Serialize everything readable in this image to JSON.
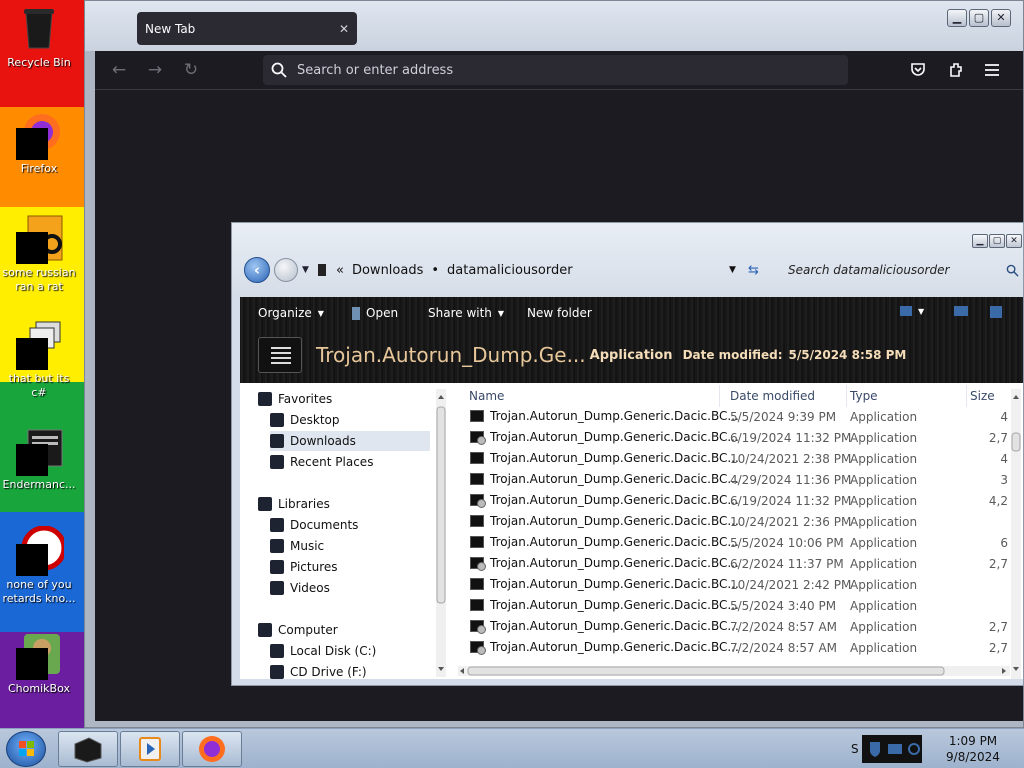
{
  "desktop": {
    "icons": [
      {
        "label": "Recycle Bin"
      },
      {
        "label": "Firefox"
      },
      {
        "label": "some russian ran a rat"
      },
      {
        "label": "that but its c#"
      },
      {
        "label": "Endermanc..."
      },
      {
        "label": "none of you retards kno..."
      },
      {
        "label": "ChomikBox"
      }
    ],
    "colors": [
      "#e8120f",
      "#ff8b00",
      "#ffee00",
      "#18a53c",
      "#1a67d6",
      "#6b1fa0"
    ]
  },
  "firefox": {
    "tab_title": "New Tab",
    "tab_close": "✕",
    "address_placeholder": "Search or enter address",
    "window_buttons": [
      "▁",
      "▢",
      "✕"
    ]
  },
  "explorer": {
    "window_buttons": [
      "▁",
      "▢",
      "✕"
    ],
    "breadcrumb_prefix": "«",
    "breadcrumb": [
      "Downloads",
      "datamaliciousorder"
    ],
    "breadcrumb_separator": "•",
    "search_placeholder": "Search datamaliciousorder",
    "toolbar": {
      "organize": "Organize",
      "open": "Open",
      "share_with": "Share with",
      "new_folder": "New folder"
    },
    "details": {
      "name": "Trojan.Autorun_Dump.Ge...",
      "type": "Application",
      "modified_label": "Date modified:",
      "modified_value": "5/5/2024 8:58 PM"
    },
    "nav_tree": [
      {
        "label": "Favorites",
        "indent": 0,
        "selected": false
      },
      {
        "label": "Desktop",
        "indent": 1,
        "selected": false
      },
      {
        "label": "Downloads",
        "indent": 1,
        "selected": true
      },
      {
        "label": "Recent Places",
        "indent": 1,
        "selected": false
      },
      {
        "label": "",
        "indent": 0,
        "selected": false
      },
      {
        "label": "Libraries",
        "indent": 0,
        "selected": false
      },
      {
        "label": "Documents",
        "indent": 1,
        "selected": false
      },
      {
        "label": "Music",
        "indent": 1,
        "selected": false
      },
      {
        "label": "Pictures",
        "indent": 1,
        "selected": false
      },
      {
        "label": "Videos",
        "indent": 1,
        "selected": false
      },
      {
        "label": "",
        "indent": 0,
        "selected": false
      },
      {
        "label": "Computer",
        "indent": 0,
        "selected": false
      },
      {
        "label": "Local Disk (C:)",
        "indent": 1,
        "selected": false
      },
      {
        "label": "CD Drive (F:)",
        "indent": 1,
        "selected": false
      }
    ],
    "columns": [
      "Name",
      "Date modified",
      "Type",
      "Size"
    ],
    "files": [
      {
        "name": "Trojan.Autorun_Dump.Generic.Dacic.BC...",
        "date": "5/5/2024 9:39 PM",
        "type": "Application",
        "size": "4",
        "gear": false
      },
      {
        "name": "Trojan.Autorun_Dump.Generic.Dacic.BC...",
        "date": "6/19/2024 11:32 PM",
        "type": "Application",
        "size": "2,7",
        "gear": true
      },
      {
        "name": "Trojan.Autorun_Dump.Generic.Dacic.BC...",
        "date": "10/24/2021 2:38 PM",
        "type": "Application",
        "size": "4",
        "gear": false
      },
      {
        "name": "Trojan.Autorun_Dump.Generic.Dacic.BC...",
        "date": "4/29/2024 11:36 PM",
        "type": "Application",
        "size": "3",
        "gear": false
      },
      {
        "name": "Trojan.Autorun_Dump.Generic.Dacic.BC...",
        "date": "6/19/2024 11:32 PM",
        "type": "Application",
        "size": "4,2",
        "gear": true
      },
      {
        "name": "Trojan.Autorun_Dump.Generic.Dacic.BC...",
        "date": "10/24/2021 2:36 PM",
        "type": "Application",
        "size": "",
        "gear": false
      },
      {
        "name": "Trojan.Autorun_Dump.Generic.Dacic.BC...",
        "date": "5/5/2024 10:06 PM",
        "type": "Application",
        "size": "6",
        "gear": false
      },
      {
        "name": "Trojan.Autorun_Dump.Generic.Dacic.BC...",
        "date": "6/2/2024 11:37 PM",
        "type": "Application",
        "size": "2,7",
        "gear": true
      },
      {
        "name": "Trojan.Autorun_Dump.Generic.Dacic.BC...",
        "date": "10/24/2021 2:42 PM",
        "type": "Application",
        "size": "",
        "gear": false
      },
      {
        "name": "Trojan.Autorun_Dump.Generic.Dacic.BC...",
        "date": "5/5/2024 3:40 PM",
        "type": "Application",
        "size": "",
        "gear": false
      },
      {
        "name": "Trojan.Autorun_Dump.Generic.Dacic.BC...",
        "date": "7/2/2024 8:57 AM",
        "type": "Application",
        "size": "2,7",
        "gear": true
      },
      {
        "name": "Trojan.Autorun_Dump.Generic.Dacic.BC...",
        "date": "7/2/2024 8:57 AM",
        "type": "Application",
        "size": "2,7",
        "gear": true
      }
    ]
  },
  "taskbar": {
    "time": "1:09 PM",
    "date": "9/8/2024",
    "tray_letter": "S"
  }
}
